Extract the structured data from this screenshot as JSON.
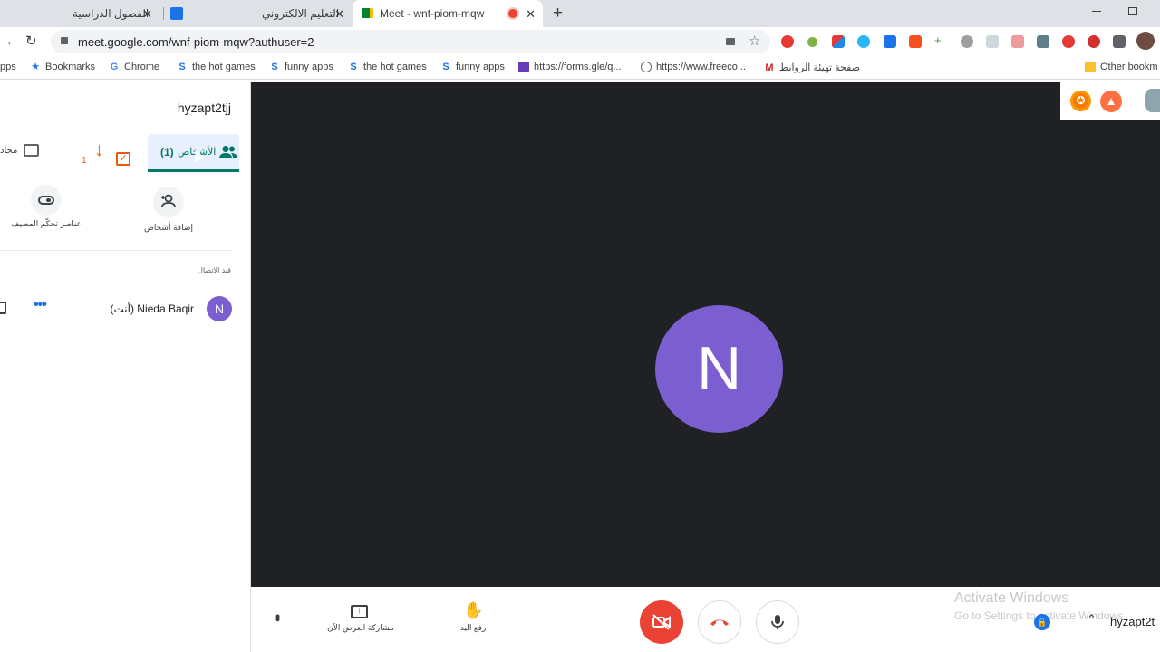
{
  "tabs": [
    {
      "title": "الفصول الدراسية",
      "close": "✕"
    },
    {
      "title": "التعليم الالكتروني",
      "close": "✕"
    },
    {
      "title": "Meet - wnf-piom-mqw",
      "close": "✕"
    }
  ],
  "new_tab": "+",
  "address": {
    "url": "meet.google.com/wnf-piom-mqw?authuser=2"
  },
  "bookmarks": [
    {
      "label": "pps"
    },
    {
      "label": "Bookmarks"
    },
    {
      "label": "Chrome"
    },
    {
      "label": "the hot games"
    },
    {
      "label": "funny apps"
    },
    {
      "label": "the hot games"
    },
    {
      "label": "funny apps"
    },
    {
      "label": "https://forms.gle/q..."
    },
    {
      "label": "https://www.freeco..."
    },
    {
      "label": "صفحة تهيئة الروابط"
    },
    {
      "label": "Other bookm"
    }
  ],
  "panel": {
    "meeting_name": "hyzapt2tjj",
    "tab_chat": "محاد",
    "tab_activities_badge": "1",
    "tab_people": "الأشخاص",
    "tab_people_count": "(1)",
    "host_controls": "عناصر تحكّم المضيف",
    "add_people": "إضافة أشخاص",
    "section_label": "قيد الاتصال",
    "participant": {
      "initial": "N",
      "name": "Nieda Baqir",
      "suffix": "(أنت)"
    }
  },
  "stage": {
    "initial": "N"
  },
  "controls": {
    "present_label": "مشاركة العرض الآن",
    "raise_hand_label": "رفع اليد",
    "meeting_name_short": "hyzapt2t"
  },
  "watermark": {
    "title": "Activate Windows",
    "subtitle": "Go to Settings to activate Windows."
  },
  "colors": {
    "accent": "#00796b",
    "avatar": "#7b5fd1",
    "danger": "#ea4335",
    "activities": "#e8590c"
  }
}
